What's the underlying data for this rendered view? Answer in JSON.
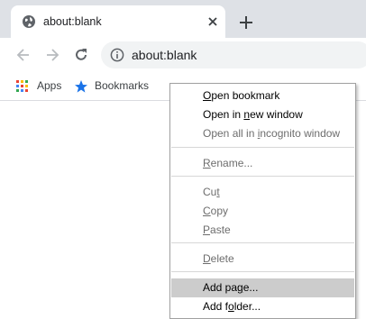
{
  "tab": {
    "title": "about:blank"
  },
  "omnibox": {
    "url": "about:blank"
  },
  "bookmarks_bar": {
    "items": [
      {
        "label": "Apps",
        "icon": "apps-grid-icon"
      },
      {
        "label": "Bookmarks",
        "icon": "star-icon"
      }
    ]
  },
  "context_menu": {
    "items": [
      {
        "pre": "",
        "key": "O",
        "post": "pen bookmark",
        "enabled": true
      },
      {
        "pre": "Open in ",
        "key": "n",
        "post": "ew window",
        "enabled": true
      },
      {
        "pre": "Open all in ",
        "key": "i",
        "post": "ncognito window",
        "enabled": false
      },
      {
        "pre": "",
        "key": "R",
        "post": "ename...",
        "enabled": false
      },
      {
        "pre": "Cu",
        "key": "t",
        "post": "",
        "enabled": false
      },
      {
        "pre": "",
        "key": "C",
        "post": "opy",
        "enabled": false
      },
      {
        "pre": "",
        "key": "P",
        "post": "aste",
        "enabled": false
      },
      {
        "pre": "",
        "key": "D",
        "post": "elete",
        "enabled": false
      },
      {
        "pre": "Add pa",
        "key": "g",
        "post": "e...",
        "enabled": true,
        "highlighted": true
      },
      {
        "pre": "Add f",
        "key": "o",
        "post": "lder...",
        "enabled": true
      }
    ]
  },
  "colors": {
    "tabstrip": "#dee1e6",
    "omnibox": "#f1f3f4",
    "highlight": "#cccccc"
  }
}
